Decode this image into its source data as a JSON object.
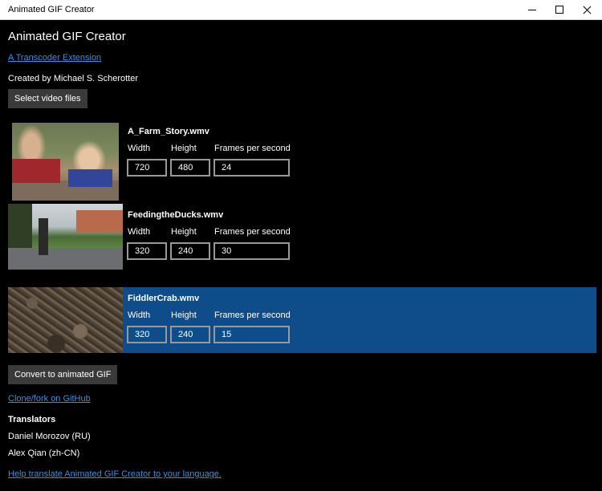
{
  "window": {
    "title": "Animated GIF Creator"
  },
  "app": {
    "title": "Animated GIF Creator",
    "extension_link": "A Transcoder Extension",
    "created_by": "Created by Michael S. Scherotter",
    "select_button": "Select video files"
  },
  "files": [
    {
      "name": "A_Farm_Story.wmv",
      "width_label": "Width",
      "height_label": "Height",
      "fps_label": "Frames per second",
      "width": "720",
      "height": "480",
      "fps": "24",
      "selected": false
    },
    {
      "name": "FeedingtheDucks.wmv",
      "width_label": "Width",
      "height_label": "Height",
      "fps_label": "Frames per second",
      "width": "320",
      "height": "240",
      "fps": "30",
      "selected": false
    },
    {
      "name": "FiddlerCrab.wmv",
      "width_label": "Width",
      "height_label": "Height",
      "fps_label": "Frames per second",
      "width": "320",
      "height": "240",
      "fps": "15",
      "selected": true
    }
  ],
  "convert_button": "Convert to animated GIF",
  "github_link": "Clone/fork on GitHub",
  "translators": {
    "heading": "Translators",
    "items": [
      "Daniel Morozov (RU)",
      "Alex Qian (zh-CN)"
    ]
  },
  "help_link": "Help translate Animated GIF Creator to your language.",
  "colors": {
    "accent": "#0f4c8a",
    "link": "#3b8fe2",
    "background": "#000000",
    "button": "#3a3a3a"
  }
}
